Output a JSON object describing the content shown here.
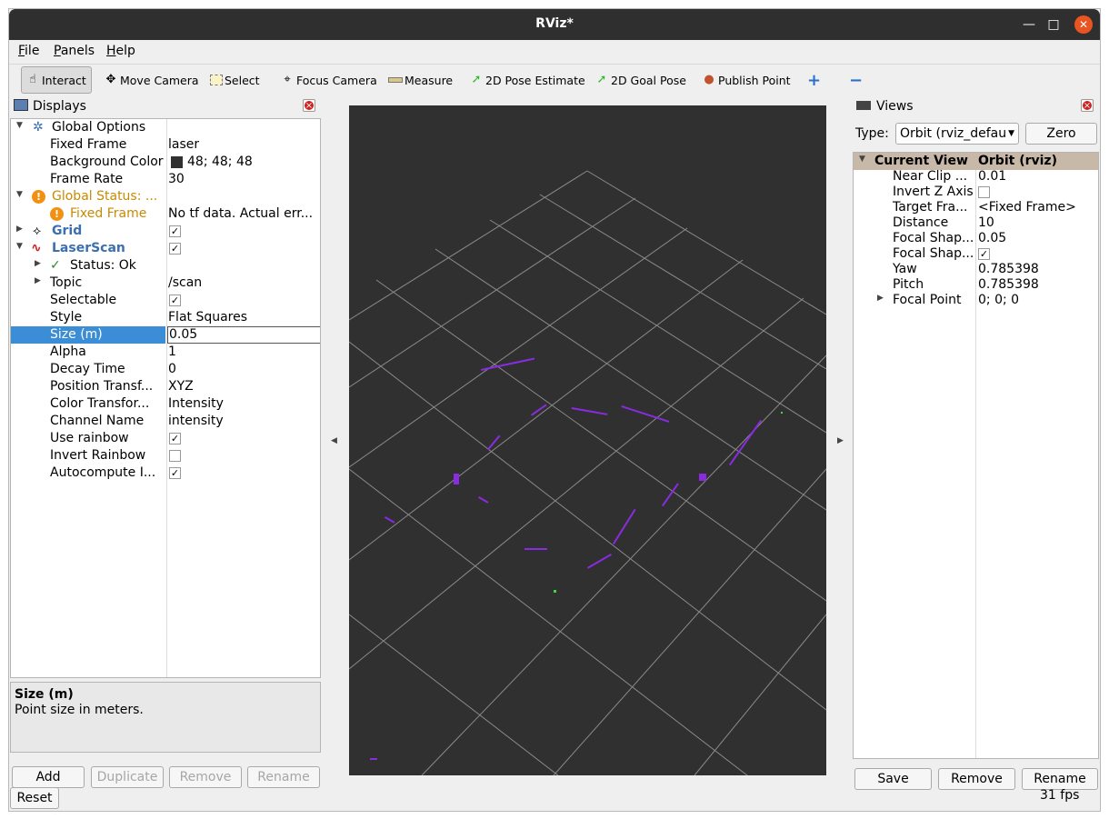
{
  "window": {
    "title": "RViz*"
  },
  "menubar": {
    "items": [
      {
        "label": "File",
        "key": "F",
        "rest": "ile"
      },
      {
        "label": "Panels",
        "key": "P",
        "rest": "anels"
      },
      {
        "label": "Help",
        "key": "H",
        "rest": "elp"
      }
    ]
  },
  "toolbar": {
    "interact": "Interact",
    "move_camera": "Move Camera",
    "select": "Select",
    "focus_camera": "Focus Camera",
    "measure": "Measure",
    "pose_estimate": "2D Pose Estimate",
    "goal_pose": "2D Goal Pose",
    "publish_point": "Publish Point"
  },
  "displays": {
    "title": "Displays",
    "global_options": "Global Options",
    "fixed_frame_label": "Fixed Frame",
    "fixed_frame_value": "laser",
    "background_color_label": "Background Color",
    "background_color_value": "48; 48; 48",
    "frame_rate_label": "Frame Rate",
    "frame_rate_value": "30",
    "global_status_label": "Global Status: ...",
    "global_status_fixed_frame": "Fixed Frame",
    "global_status_message": "No tf data.  Actual err...",
    "grid_label": "Grid",
    "grid_enabled": true,
    "laserscan_label": "LaserScan",
    "laserscan_enabled": true,
    "status_label": "Status: Ok",
    "topic_label": "Topic",
    "topic_value": "/scan",
    "selectable_label": "Selectable",
    "style_label": "Style",
    "style_value": "Flat Squares",
    "size_label": "Size (m)",
    "size_value": "0.05",
    "alpha_label": "Alpha",
    "alpha_value": "1",
    "decay_label": "Decay Time",
    "decay_value": "0",
    "position_label": "Position Transf...",
    "position_value": "XYZ",
    "color_label": "Color Transfor...",
    "color_value": "Intensity",
    "channel_label": "Channel Name",
    "channel_value": "intensity",
    "rainbow_label": "Use rainbow",
    "invert_rainbow_label": "Invert Rainbow",
    "autocompute_label": "Autocompute I...",
    "help_title": "Size (m)",
    "help_text": "Point size in meters.",
    "add": "Add",
    "duplicate": "Duplicate",
    "remove": "Remove",
    "rename": "Rename"
  },
  "reset": "Reset",
  "views": {
    "title": "Views",
    "type_label": "Type:",
    "type_value": "Orbit (rviz_defau",
    "zero": "Zero",
    "current_view": "Current View",
    "current_view_value": "Orbit (rviz)",
    "near_clip_label": "Near Clip ...",
    "near_clip_value": "0.01",
    "invert_z_label": "Invert Z Axis",
    "target_frame_label": "Target Fra...",
    "target_frame_value": "<Fixed Frame>",
    "distance_label": "Distance",
    "distance_value": "10",
    "focal_shape_size_label": "Focal Shap...",
    "focal_shape_size_value": "0.05",
    "focal_shape_fixed_label": "Focal Shap...",
    "yaw_label": "Yaw",
    "yaw_value": "0.785398",
    "pitch_label": "Pitch",
    "pitch_value": "0.785398",
    "focal_point_label": "Focal Point",
    "focal_point_value": "0; 0; 0",
    "save": "Save",
    "remove": "Remove",
    "rename": "Rename"
  },
  "status": {
    "fps": "31 fps"
  },
  "colors": {
    "viewport_bg": "#303030",
    "warning": "#c88a00",
    "selection": "#3b8ed5",
    "laser_points": "#8a2be2"
  }
}
